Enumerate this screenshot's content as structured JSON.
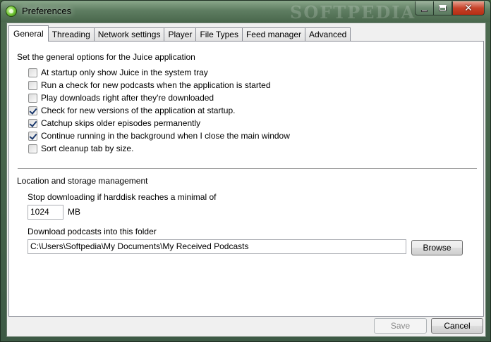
{
  "window": {
    "title": "Preferences",
    "watermark": "SOFTPEDIA"
  },
  "tabs": [
    {
      "label": "General",
      "active": true
    },
    {
      "label": "Threading",
      "active": false
    },
    {
      "label": "Network settings",
      "active": false
    },
    {
      "label": "Player",
      "active": false
    },
    {
      "label": "File Types",
      "active": false
    },
    {
      "label": "Feed manager",
      "active": false
    },
    {
      "label": "Advanced",
      "active": false
    }
  ],
  "general": {
    "section_label": "Set the general options for the Juice application",
    "options": [
      {
        "label": "At startup only show Juice in the system tray",
        "checked": false
      },
      {
        "label": "Run a check for new podcasts when the application is started",
        "checked": false
      },
      {
        "label": "Play downloads right after they're downloaded",
        "checked": false
      },
      {
        "label": "Check for new versions of the application at startup.",
        "checked": true
      },
      {
        "label": "Catchup skips older episodes permanently",
        "checked": true
      },
      {
        "label": "Continue running in the background when I close the main window",
        "checked": true
      },
      {
        "label": "Sort cleanup tab by size.",
        "checked": false
      }
    ]
  },
  "storage": {
    "section_label": "Location and storage management",
    "min_disk_label": "Stop downloading if harddisk reaches a minimal of",
    "min_disk_value": "1024",
    "min_disk_unit": "MB",
    "folder_label": "Download podcasts into this folder",
    "folder_value": "C:\\Users\\Softpedia\\My Documents\\My Received Podcasts",
    "browse_label": "Browse"
  },
  "footer": {
    "save_label": "Save",
    "save_enabled": false,
    "cancel_label": "Cancel"
  }
}
